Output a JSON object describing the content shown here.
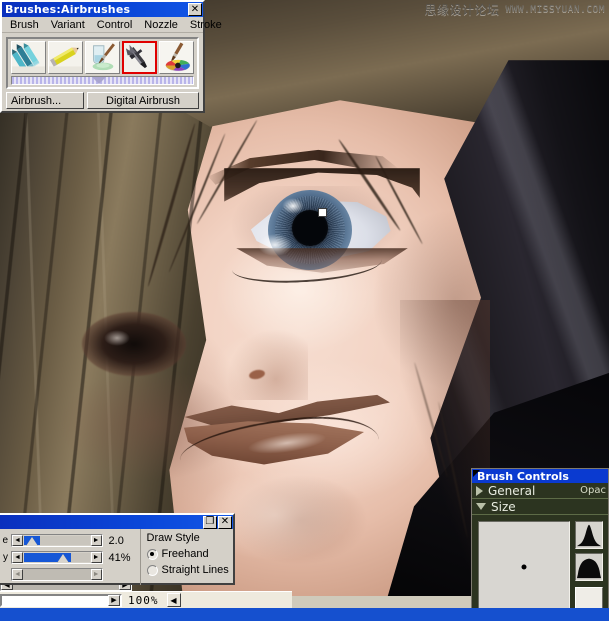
{
  "app": {
    "watermark_cn": "思缘设计论坛",
    "watermark_url": "WWW.MISSYUAN.COM"
  },
  "brushes_palette": {
    "title": "Brushes:Airbrushes",
    "close_label": "✕",
    "menu": [
      {
        "label": "Brush"
      },
      {
        "label": "Variant"
      },
      {
        "label": "Control"
      },
      {
        "label": "Nozzle"
      },
      {
        "label": "Stroke"
      }
    ],
    "icons": [
      {
        "name": "colored-pencils-icon",
        "selected": false
      },
      {
        "name": "pencil-icon",
        "selected": false
      },
      {
        "name": "water-glass-brush-icon",
        "selected": false
      },
      {
        "name": "airbrush-icon",
        "selected": true
      },
      {
        "name": "color-wheel-brush-icon",
        "selected": false
      }
    ],
    "category_button": "Airbrush...",
    "variant_button": "Digital Airbrush"
  },
  "tool_palette": {
    "title": "",
    "restore_label": "❐",
    "close_label": "✕",
    "sliders": [
      {
        "name": "size-slider",
        "label": "e",
        "value": "2.0",
        "fill_pct": 14,
        "knob_pct": 11,
        "disabled": false
      },
      {
        "name": "opacity-slider",
        "label": "y",
        "value": "41%",
        "fill_pct": 48,
        "knob_pct": 44,
        "disabled": false
      },
      {
        "name": "grain-slider",
        "label": "",
        "value": "",
        "fill_pct": 0,
        "knob_pct": 0,
        "disabled": true
      }
    ],
    "draw_style": {
      "title": "Draw Style",
      "options": [
        {
          "label": "Freehand",
          "selected": true
        },
        {
          "label": "Straight Lines",
          "selected": false
        }
      ]
    }
  },
  "status": {
    "zoom": "100%",
    "left_arrow": "◀",
    "right_arrow": "▶",
    "nav_arrow": "◀"
  },
  "brush_controls": {
    "title": "Brush Controls",
    "sections": [
      {
        "name": "general",
        "label": "General",
        "expanded": false,
        "aux": "Opac"
      },
      {
        "name": "size",
        "label": "Size",
        "expanded": true,
        "aux": ""
      }
    ],
    "size_preview_name": "size-preview",
    "profiles": [
      {
        "name": "brush-profile-flat-tip"
      },
      {
        "name": "brush-profile-round-tip"
      }
    ]
  },
  "canvas": {
    "artwork_name": "digital-portrait-painting",
    "cursor_name": "brush-cursor"
  }
}
